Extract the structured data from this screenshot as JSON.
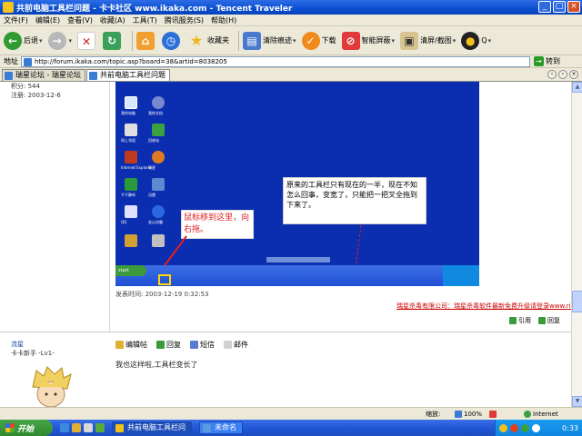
{
  "window": {
    "title": "共前电脑工具栏问题 - 卡卡社区 www.ikaka.com - Tencent Traveler"
  },
  "menu": [
    "文件(F)",
    "编辑(E)",
    "查看(V)",
    "收藏(A)",
    "工具(T)",
    "腾讯服务(S)",
    "帮助(H)"
  ],
  "toolbar": {
    "back": "后退",
    "favorites": "收藏夹",
    "clean": "清除痕迹",
    "download": "下载",
    "block_ads": "智能屏蔽",
    "close_all": "清屏/截图",
    "qq": "Q"
  },
  "address": {
    "label": "地址",
    "url": "http://forum.ikaka.com/topic.asp?board=38&artid=8038205",
    "go": "转到"
  },
  "tabs": [
    {
      "label": "瑞星论坛 - 瑞星论坛"
    },
    {
      "label": "共前电脑工具栏问题"
    }
  ],
  "post": {
    "author_meta_1": "积分: 544",
    "author_meta_2": "注册: 2003-12-6",
    "annotation_red": "鼠标移到这里，向右拖。",
    "annotation_black": "原来的工具栏只有现在的一半，现在不知怎么回事，变宽了，只能把一把叉全拖到下来了。",
    "time": "发表时间: 2003-12-19 0:32:53",
    "red_link": "瑞星杀毒有限公司：瑞星杀毒软件最新免费升级请登录www.rising.com.cn",
    "quote": "引用",
    "reply": "回复"
  },
  "reply": {
    "username": "流星",
    "rank": "卡卡新手 -Lv1-",
    "actions": [
      "编辑帖",
      "回复",
      "短信",
      "邮件"
    ],
    "text": "我也这样啦,工具栏变长了"
  },
  "statusbar": {
    "zoom": "缩放:",
    "pct": "100%",
    "net": "Internet"
  },
  "taskbar": {
    "start": "开始",
    "tasks": [
      "共前电脑工具栏问",
      "未命名"
    ],
    "clock": "0:33"
  },
  "desktop_icons": [
    "我的电脑",
    "我的文档",
    "网上邻居",
    "回收站",
    "Internet Explorer",
    "瑞星",
    "千千静听",
    "迅雷",
    "QQ",
    "金山词霸"
  ]
}
